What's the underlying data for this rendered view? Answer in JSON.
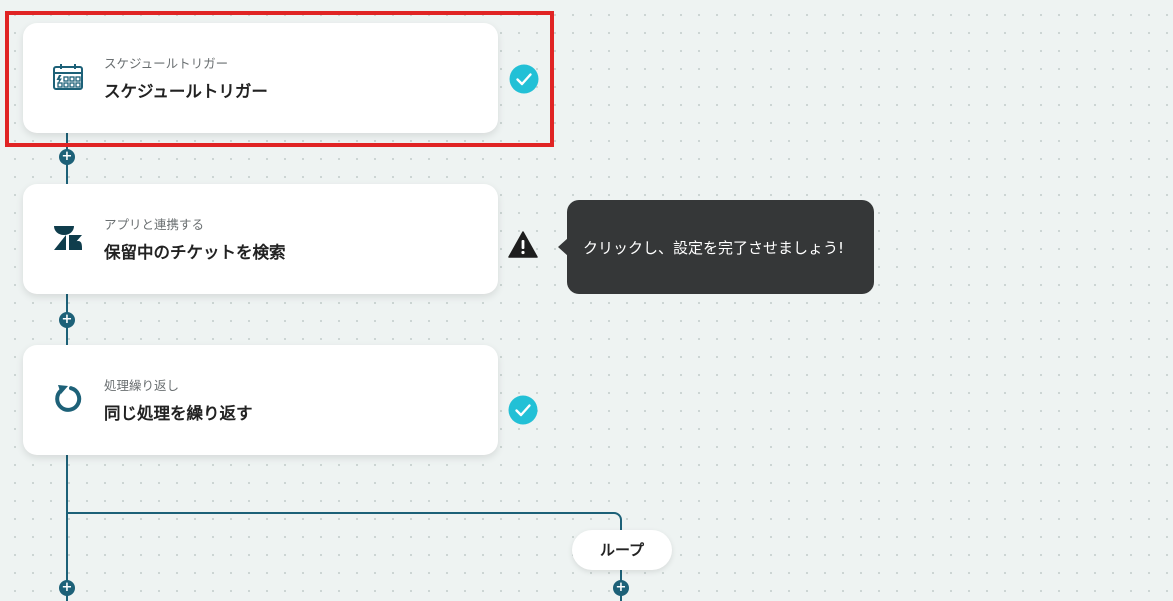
{
  "steps": [
    {
      "subtitle": "スケジュールトリガー",
      "title": "スケジュールトリガー",
      "icon": "calendar-schedule-icon",
      "status": "complete"
    },
    {
      "subtitle": "アプリと連携する",
      "title": "保留中のチケットを検索",
      "icon": "zendesk-logo-icon",
      "status": "warning"
    },
    {
      "subtitle": "処理繰り返し",
      "title": "同じ処理を繰り返す",
      "icon": "loop-repeat-icon",
      "status": "complete"
    }
  ],
  "tooltip": {
    "text": "クリックし、設定を完了させましょう!"
  },
  "loop_label": "ループ",
  "add_button_glyph": "+",
  "colors": {
    "connector": "#1d6178",
    "check": "#22c0d6",
    "highlight": "#e02424",
    "tooltip_bg": "#353738"
  }
}
